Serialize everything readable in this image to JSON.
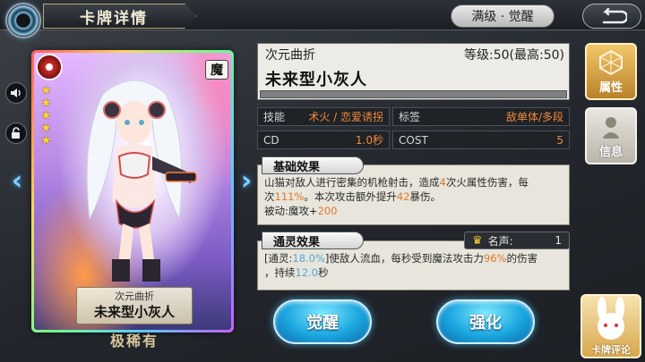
{
  "header": {
    "title": "卡牌详情",
    "awaken_level_label": "满级 · 觉醒",
    "back_icon": "return-arrow-icon"
  },
  "side_controls": {
    "sound_icon": "speaker-icon",
    "lock_icon": "unlock-icon",
    "prev_arrow": "‹",
    "next_arrow": "›"
  },
  "card": {
    "element_icon": "fire-element-icon",
    "type_badge": "魔",
    "stars": 5,
    "series": "次元曲折",
    "name": "未来型小灰人",
    "rarity": "极稀有"
  },
  "info": {
    "series": "次元曲折",
    "level_text": "等级:50(最高:50)",
    "name": "未来型小灰人",
    "xp_fraction": 1.0
  },
  "stats": {
    "skill_key": "技能",
    "skill_val": "术火 / 恋爱诱拐",
    "tag_key": "标签",
    "tag_val": "敌单体/多段",
    "cd_key": "CD",
    "cd_val": "1.0秒",
    "cost_key": "COST",
    "cost_val": "5"
  },
  "base_effect": {
    "title": "基础效果",
    "line1_a": "山猫对敌人进行密集的机枪射击，造成",
    "line1_b": "4",
    "line1_c": "次火属性伤害，每",
    "line2_a": "次",
    "line2_b": "111%",
    "line2_c": "。本次攻击额外提升",
    "line2_d": "42",
    "line2_e": "暴伤。",
    "line3_a": "被动:魔攻+",
    "line3_b": "200"
  },
  "spirit_effect": {
    "title": "通灵效果",
    "fame_label": "名声:",
    "fame_value": "1",
    "line1_a": "[通灵:",
    "line1_b": "18.0%",
    "line1_c": "]使敌人流血，每秒受到魔法攻击力",
    "line1_d": "96%",
    "line1_e": "的伤害",
    "line2_a": "，持续",
    "line2_b": "12.0",
    "line2_c": "秒"
  },
  "buttons": {
    "awaken": "觉醒",
    "enhance": "强化"
  },
  "side_tabs": {
    "attr": "属性",
    "attr_icon": "hexagon-attribute-icon",
    "info": "信息",
    "info_icon": "bust-info-icon"
  },
  "review": {
    "label": "卡牌评论",
    "icon": "bunny-mascot-icon"
  },
  "colors": {
    "accent_orange": "#e07a2a",
    "accent_blue": "#1ba6e0",
    "panel_bg": "#e8e5dc"
  }
}
